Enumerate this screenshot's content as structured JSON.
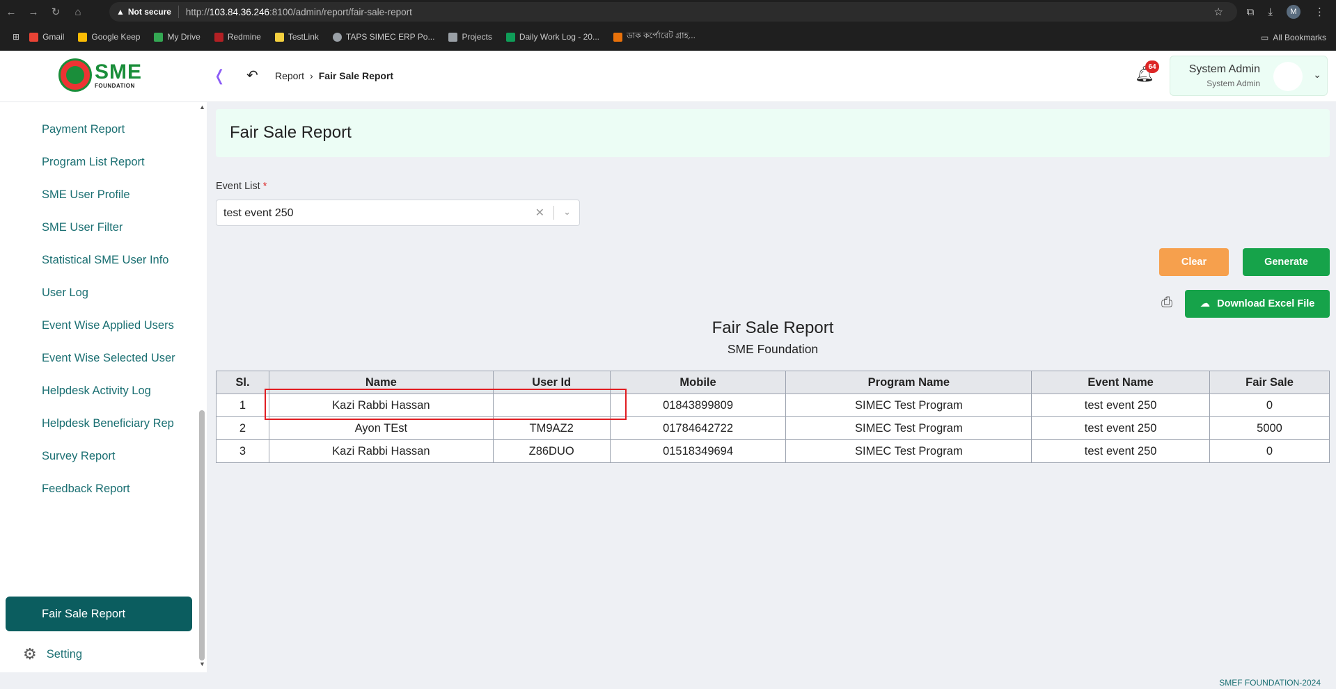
{
  "browser": {
    "security_label": "Not secure",
    "url_host": "103.84.36.246",
    "url_rest": ":8100/admin/report/fair-sale-report",
    "url_scheme": "http://",
    "profile_initial": "M",
    "bookmarks": [
      {
        "label": "Gmail",
        "color": "#ea4335"
      },
      {
        "label": "Google Keep",
        "color": "#fbbc04"
      },
      {
        "label": "My Drive",
        "color": "#34a853"
      },
      {
        "label": "Redmine",
        "color": "#b32024"
      },
      {
        "label": "TestLink",
        "color": "#f4d03f"
      },
      {
        "label": "TAPS SIMEC ERP Po...",
        "color": "#9aa0a6"
      },
      {
        "label": "Projects",
        "color": "#9aa0a6"
      },
      {
        "label": "Daily Work Log - 20...",
        "color": "#0f9d58"
      },
      {
        "label": "ডাক কর্পোরেট গ্রাহ...",
        "color": "#e8710a"
      }
    ],
    "all_bookmarks": "All Bookmarks"
  },
  "header": {
    "logo_text": "SME",
    "logo_sub": "FOUNDATION",
    "breadcrumb_parent": "Report",
    "breadcrumb_current": "Fair Sale Report",
    "notification_count": "64",
    "user_name": "System Admin",
    "user_role": "System Admin"
  },
  "sidebar": {
    "items": [
      {
        "label": "Payment Report"
      },
      {
        "label": "Program List Report"
      },
      {
        "label": "SME User Profile"
      },
      {
        "label": "SME User Filter"
      },
      {
        "label": "Statistical SME User Info"
      },
      {
        "label": "User Log"
      },
      {
        "label": "Event Wise Applied Users"
      },
      {
        "label": "Event Wise Selected User"
      },
      {
        "label": "Helpdesk Activity Log"
      },
      {
        "label": "Helpdesk Beneficiary Rep"
      },
      {
        "label": "Survey Report"
      },
      {
        "label": "Feedback Report"
      },
      {
        "label": "Fair Sale Report"
      }
    ],
    "setting_label": "Setting"
  },
  "main": {
    "page_title": "Fair Sale Report",
    "event_list_label": "Event List",
    "required_mark": "*",
    "event_selected": "test event 250",
    "clear_label": "Clear",
    "generate_label": "Generate",
    "download_label": "Download Excel File",
    "report_title": "Fair Sale Report",
    "report_subtitle": "SME Foundation",
    "table": {
      "columns": [
        "Sl.",
        "Name",
        "User Id",
        "Mobile",
        "Program Name",
        "Event Name",
        "Fair Sale"
      ],
      "rows": [
        [
          "1",
          "Kazi Rabbi Hassan",
          "",
          "01843899809",
          "SIMEC Test Program",
          "test event 250",
          "0"
        ],
        [
          "2",
          "Ayon TEst",
          "TM9AZ2",
          "01784642722",
          "SIMEC Test Program",
          "test event 250",
          "5000"
        ],
        [
          "3",
          "Kazi Rabbi Hassan",
          "Z86DUO",
          "01518349694",
          "SIMEC Test Program",
          "test event 250",
          "0"
        ]
      ]
    }
  },
  "footer": "SMEF FOUNDATION-2024"
}
